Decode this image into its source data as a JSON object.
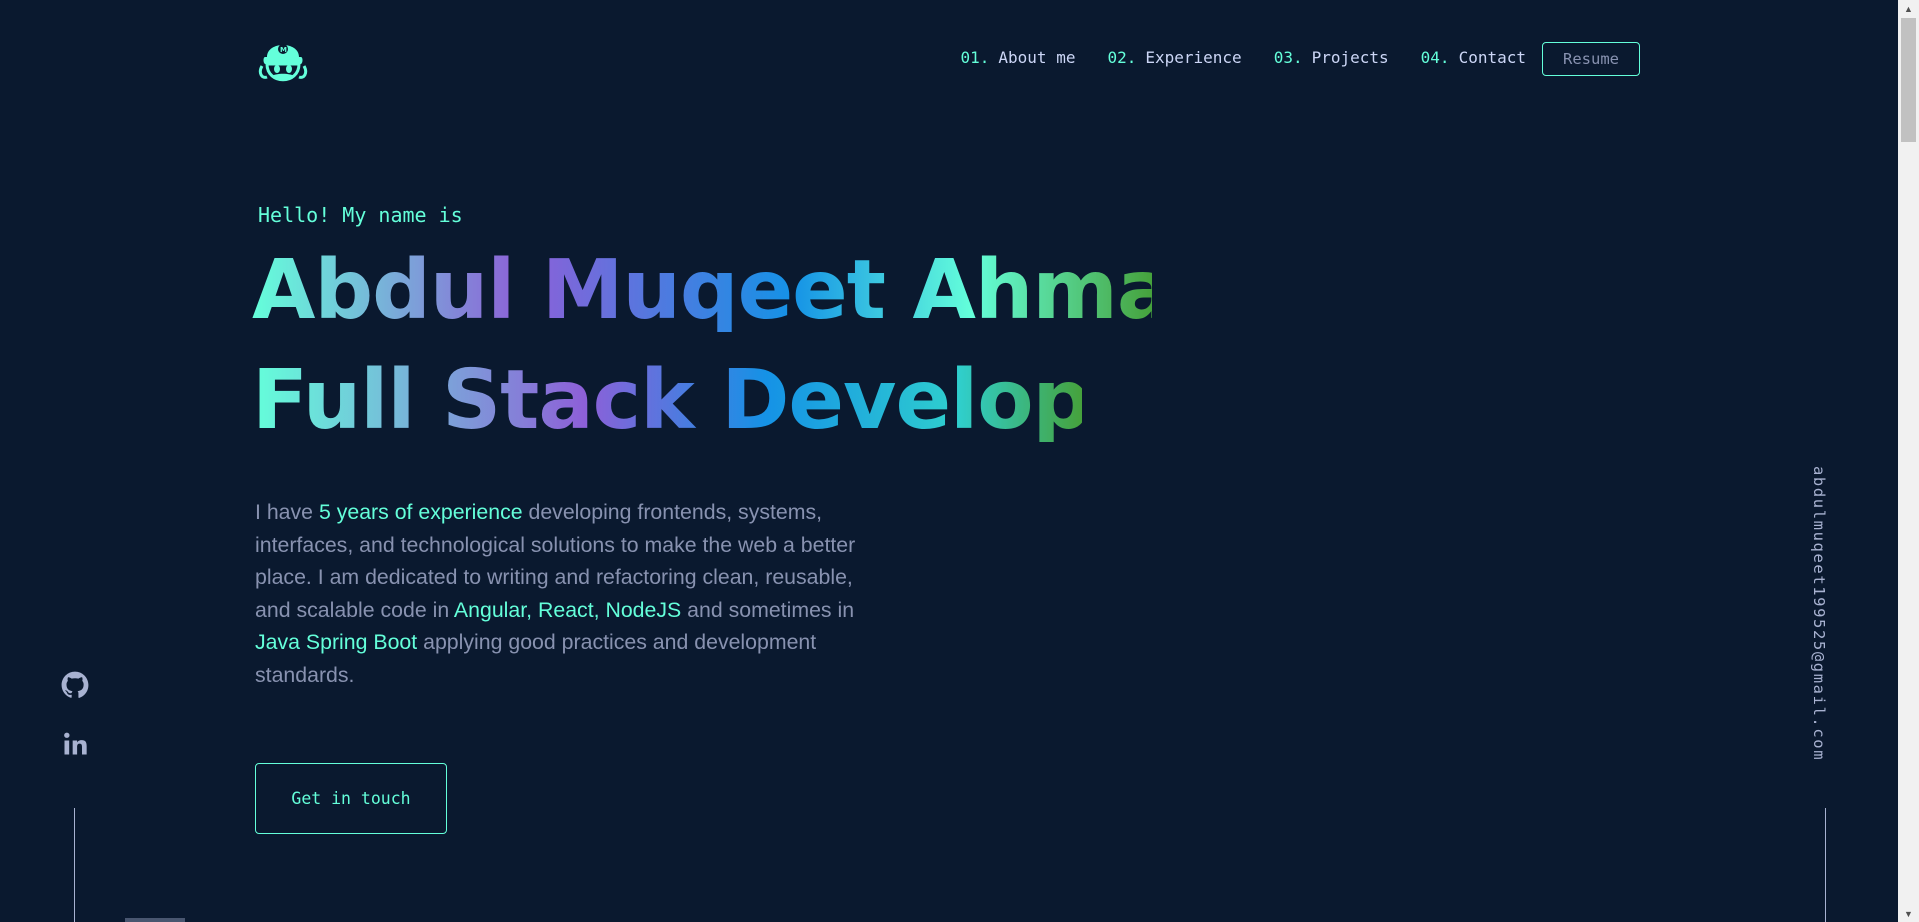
{
  "nav": {
    "items": [
      {
        "num": "01.",
        "label": "About me"
      },
      {
        "num": "02.",
        "label": "Experience"
      },
      {
        "num": "03.",
        "label": "Projects"
      },
      {
        "num": "04.",
        "label": "Contact"
      }
    ],
    "resume_label": "Resume"
  },
  "hero": {
    "greeting": "Hello! My name is",
    "name": "Abdul Muqeet Ahmad.",
    "role": "Full Stack Developer",
    "bio": {
      "p1": "I have ",
      "h1": "5 years of experience",
      "p2": " developing frontends, systems, interfaces, and technological solutions to make the web a better place. I am dedicated to writing and refactoring clean, reusable, and scalable code in ",
      "h2": "Angular, React, NodeJS",
      "p3": " and sometimes in ",
      "h3": "Java Spring Boot",
      "p4": " applying good practices and development standards."
    },
    "cta_label": "Get in touch"
  },
  "side": {
    "email": "abdulmuqeet199525@gmail.com",
    "socials": [
      "github-icon",
      "linkedin-icon"
    ]
  },
  "colors": {
    "background": "#0a192f",
    "accent": "#64ffda",
    "text": "#8892b0",
    "heading": "#ccd6f6"
  }
}
